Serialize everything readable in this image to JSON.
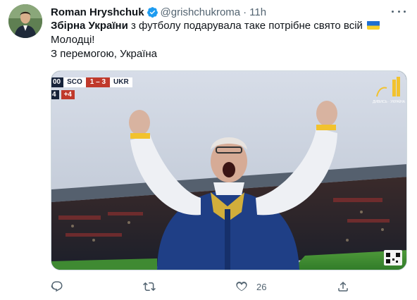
{
  "author": {
    "display_name": "Roman Hryshchuk",
    "handle": "@grishchukroma",
    "separator": "·",
    "time": "11h"
  },
  "tweet": {
    "line1_bold": "Збірна України",
    "line1_rest": " з футболу подарувала таке потрібне свято всій",
    "line2": "Молодці!",
    "line3": "З перемогою, Україна"
  },
  "media": {
    "score_bug": {
      "clock": "00",
      "home": "SCO",
      "score": "1 – 3",
      "away": "UKR",
      "stoppage_left": "4",
      "stoppage_added": "+4"
    },
    "channel_caption": "ДИВИСЬ · УКРАЇНА"
  },
  "actions": {
    "like_count": "26"
  },
  "colors": {
    "text_primary": "#0f1419",
    "text_secondary": "#536471",
    "verified_blue": "#1d9bf0",
    "border": "#cfd9de"
  },
  "icons": [
    "verified-badge-icon",
    "more-options-icon",
    "ukraine-flag-icon",
    "reply-icon",
    "retweet-icon",
    "like-icon",
    "share-icon"
  ]
}
